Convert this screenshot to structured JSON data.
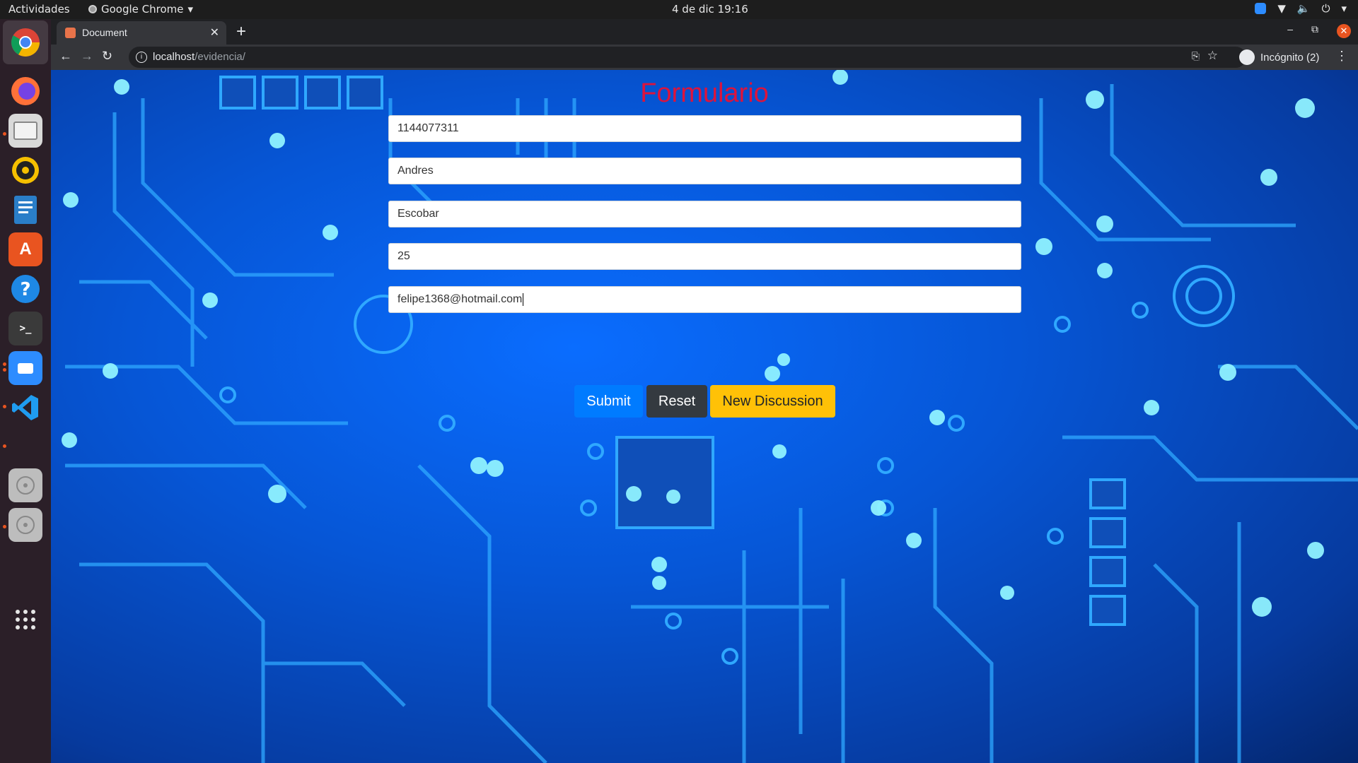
{
  "topbar": {
    "activities": "Actividades",
    "app_name": "Google Chrome",
    "clock": "4 de dic  19:16"
  },
  "dock": {
    "items": [
      "chrome-icon",
      "firefox-icon",
      "files-icon",
      "rhythmbox-icon",
      "libreoffice-writer-icon",
      "software-center-icon",
      "help-icon",
      "terminal-icon",
      "zoom-icon",
      "vscode-icon",
      "disk-icon",
      "disk-icon",
      "show-apps-icon"
    ]
  },
  "browser": {
    "tab_title": "Document",
    "url_host": "localhost",
    "url_path": "/evidencia/",
    "incognito_label": "Incógnito (2)"
  },
  "page": {
    "title": "Formulario",
    "title_color": "#dc143c",
    "fields": {
      "document": "1144077311",
      "first_name": "Andres",
      "last_name": "Escobar",
      "age": "25",
      "email": "felipe1368@hotmail.com"
    },
    "buttons": {
      "submit": "Submit",
      "reset": "Reset",
      "new_discussion": "New Discussion"
    },
    "colors": {
      "submit": "#007bff",
      "reset": "#343a40",
      "new_discussion": "#ffc107"
    }
  }
}
